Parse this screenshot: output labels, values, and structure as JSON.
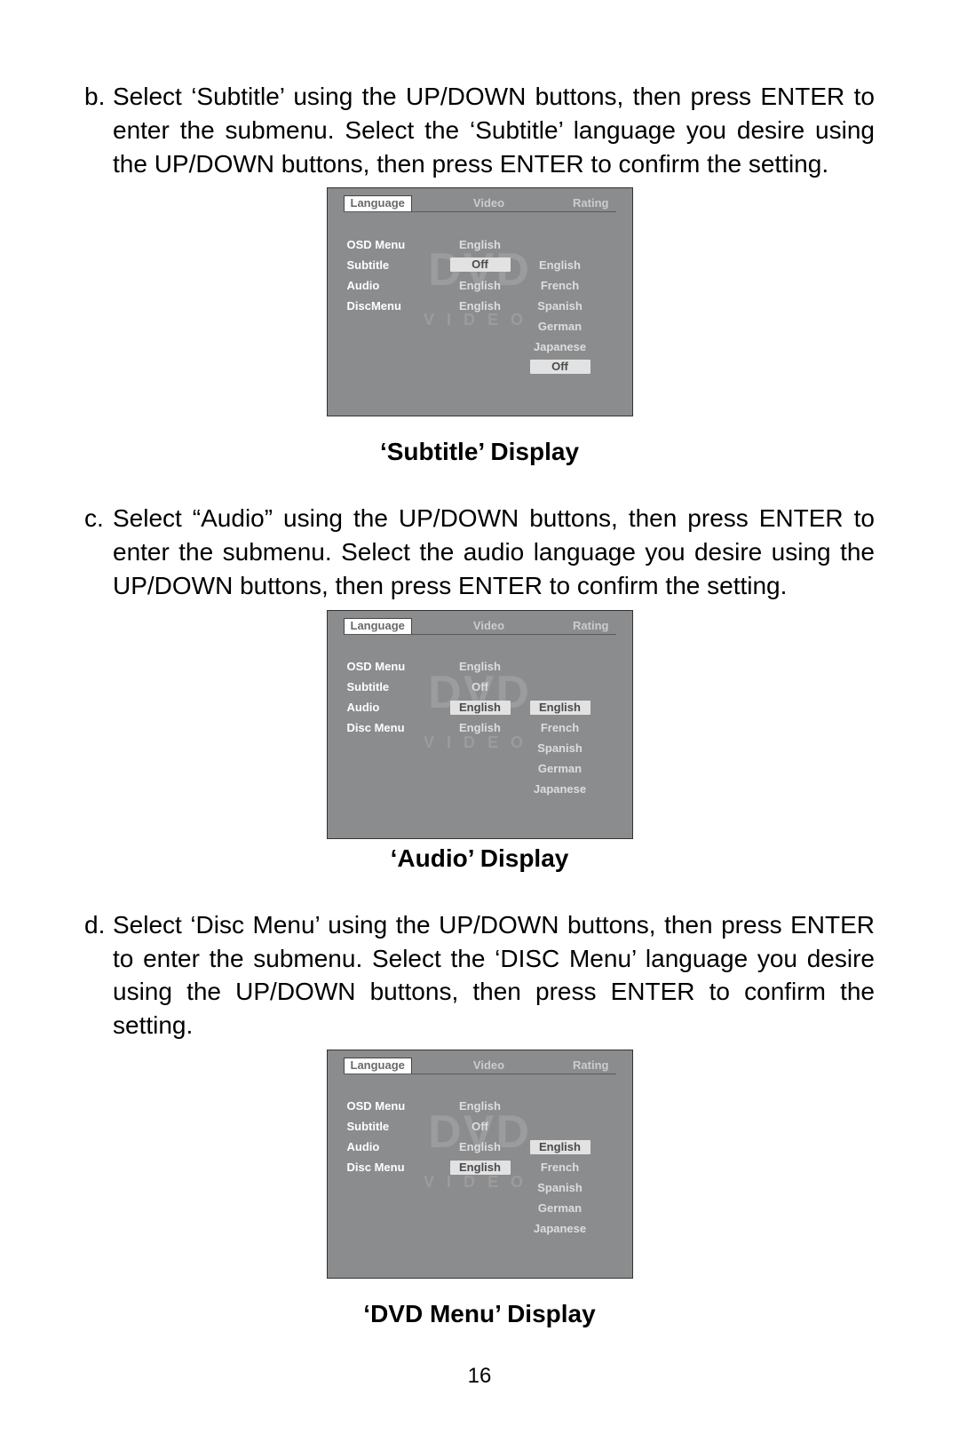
{
  "page_number": "16",
  "sections": {
    "b": {
      "label": "b.",
      "text": "Select ‘Subtitle’ using  the UP/DOWN buttons, then press  ENTER to enter the submenu. Select  the ‘Subtitle’ language you desire using  the UP/DOWN buttons, then press ENTER to confirm the setting.",
      "caption": "‘Subtitle’ Display"
    },
    "c": {
      "label": "c.",
      "text": "Select “Audio” using  the UP/DOWN buttons, then press  ENTER to enter the submenu. Select  the audio language you desire using  the UP/DOWN buttons, then press ENTER to confirm the setting.",
      "caption": "‘Audio’ Display"
    },
    "d": {
      "label": "d.",
      "text": "Select ‘Disc Menu’ using the UP/DOWN buttons, then press  ENTER to enter the submenu. Select  the ‘DISC Menu’ language you desire using  the UP/DOWN buttons, then press ENTER to confirm the setting.",
      "caption": "‘DVD Menu’ Display"
    }
  },
  "osd_common": {
    "tabs": [
      "Language",
      "Video",
      "Rating"
    ],
    "bg_dvd": "DVD",
    "bg_video": "VIDEO",
    "rows": [
      "OSD Menu",
      "Subtitle",
      "Audio",
      "DiscMenu"
    ],
    "rows_c": [
      "OSD Menu",
      "Subtitle",
      "Audio",
      "Disc Menu"
    ],
    "rows_d": [
      "OSD Menu",
      "Subtitle",
      "Audio",
      "Disc Menu"
    ]
  },
  "osd_subtitle": {
    "values": [
      "English",
      "Off",
      "English",
      "English"
    ],
    "value_selected_index": 1,
    "options": [
      "English",
      "French",
      "Spanish",
      "German",
      "Japanese",
      "Off"
    ],
    "option_selected_index": 5,
    "options_top_row": 1
  },
  "osd_audio": {
    "values": [
      "English",
      "Off",
      "English",
      "English"
    ],
    "value_selected_index": 2,
    "options": [
      "English",
      "French",
      "Spanish",
      "German",
      "Japanese"
    ],
    "option_selected_index": 0,
    "options_top_row": 2
  },
  "osd_discmenu": {
    "values": [
      "English",
      "Off",
      "English",
      "English"
    ],
    "value_selected_index": 3,
    "options": [
      "English",
      "French",
      "Spanish",
      "German",
      "Japanese"
    ],
    "option_selected_index": 0,
    "options_top_row": 2
  }
}
